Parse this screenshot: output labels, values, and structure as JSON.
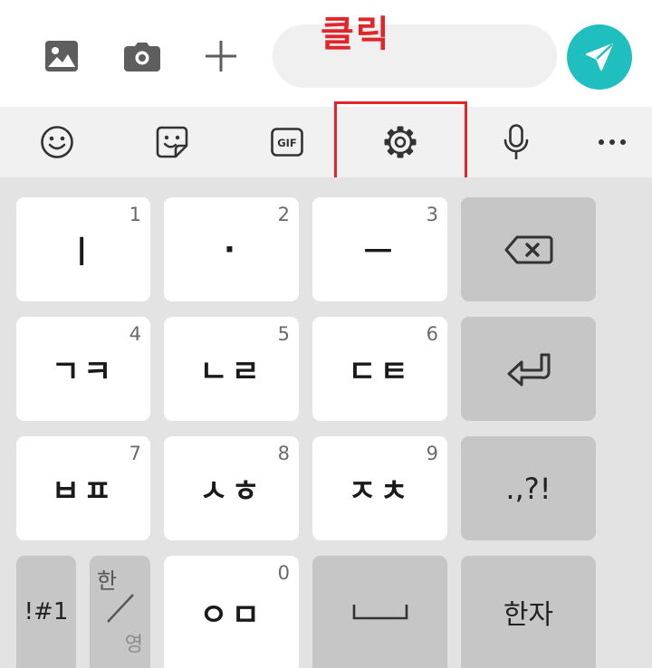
{
  "compose": {
    "input_placeholder": ""
  },
  "annotation": {
    "label": "클릭",
    "color": "#e0262a"
  },
  "toolbar": {
    "gif_label": "GIF"
  },
  "keyboard": {
    "rows": [
      [
        {
          "hint": "1",
          "label": "ㅣ"
        },
        {
          "hint": "2",
          "label": "·"
        },
        {
          "hint": "3",
          "label": "ㅡ"
        },
        {
          "label": "backspace"
        }
      ],
      [
        {
          "hint": "4",
          "label": "ㄱㅋ"
        },
        {
          "hint": "5",
          "label": "ㄴㄹ"
        },
        {
          "hint": "6",
          "label": "ㄷㅌ"
        },
        {
          "label": "enter"
        }
      ],
      [
        {
          "hint": "7",
          "label": "ㅂㅍ"
        },
        {
          "hint": "8",
          "label": "ㅅㅎ"
        },
        {
          "hint": "9",
          "label": "ㅈㅊ"
        },
        {
          "label": ".,?!"
        }
      ]
    ],
    "bottom_row": {
      "symbols_label": "!#1",
      "lang_top": "한",
      "lang_bottom": "영",
      "zero_hint": "0",
      "zero_label": "ㅇㅁ",
      "space_label": "space",
      "hanja_label": "한자"
    }
  },
  "colors": {
    "send_button": "#1fbfbf",
    "keyboard_bg": "#e3e3e3",
    "toolbar_bg": "#f1f1f1",
    "key_light": "#ffffff",
    "key_dark": "#c6c6c6"
  }
}
